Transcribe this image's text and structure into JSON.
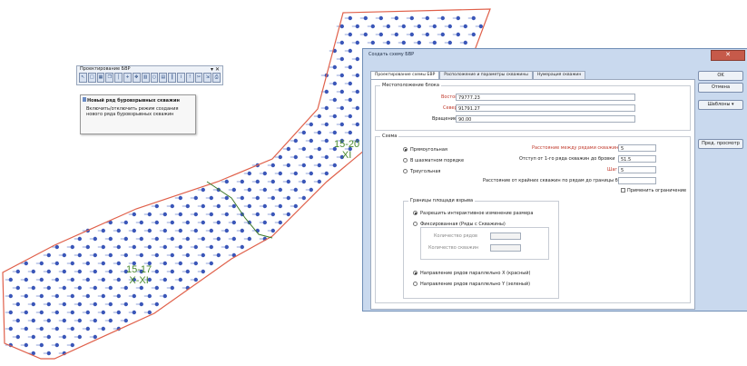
{
  "map": {
    "labels": [
      {
        "id": "label-15-20",
        "line1": "15-20",
        "line2": "XI"
      },
      {
        "id": "label-15-17",
        "line1": "15-17",
        "line2": "X-XI"
      }
    ],
    "colors": {
      "boundary": "#e0604a",
      "holes": "#3a56b8",
      "divider": "#3e7a2a"
    }
  },
  "toolbar": {
    "title": "Проектирование БВР",
    "close_glyph": "▾ ✕",
    "icons": [
      "select-icon",
      "square-icon",
      "grid-icon",
      "copy-icon",
      "line-icon",
      "plus-icon",
      "move-icon",
      "chart-icon",
      "circle-icon",
      "table-icon",
      "columns-icon",
      "info-icon",
      "warning-icon",
      "scissors-icon",
      "export-icon",
      "print-icon"
    ]
  },
  "tooltip": {
    "title": "Новый ряд буровзрывных скважин",
    "text": "Включить/отключить режим создания нового ряда буровзрывных скважин"
  },
  "dialog": {
    "title": "Создать схему БВР",
    "tabs": [
      "Проектирование схемы БВР",
      "Расположение и параметры скважины",
      "Нумерация скважин"
    ],
    "location": {
      "group_title": "Местоположение блока",
      "east_label": "Восток",
      "east_value": "79777.23",
      "north_label": "Север",
      "north_value": "91791.27",
      "rotation_label": "Вращение",
      "rotation_value": "90.00"
    },
    "scheme": {
      "group_title": "Схема",
      "options": [
        "Прямоугольная",
        "В шахматном порядке",
        "Треугольная"
      ],
      "row_spacing_label": "Расстояние между рядами скважин",
      "row_spacing_value": "5",
      "offset_label": "Отступ от 1-го ряда скважин до бровки",
      "offset_value": "51.5",
      "step_label": "Шаг",
      "step_value": "5",
      "edge_distance_label": "Расстояние от крайних скважин по рядам до границы блока",
      "edge_distance_value": "",
      "apply_limit_label": "Применить ограничение"
    },
    "area": {
      "group_title": "Границы площади взрыва",
      "options": [
        "Разрешить интерактивное изменение размера",
        "Фиксированная (Ряды с Скважины)"
      ],
      "rows_label": "Количество рядов",
      "holes_label": "Количество скважин",
      "direction_options": [
        "Направление рядов параллельно X (красный)",
        "Направление рядов параллельно Y (зеленый)"
      ]
    },
    "buttons": {
      "ok": "OK",
      "cancel": "Отмена",
      "templates": "Шаблоны ▾",
      "preview": "Пред. просмотр",
      "close": "✕"
    }
  }
}
